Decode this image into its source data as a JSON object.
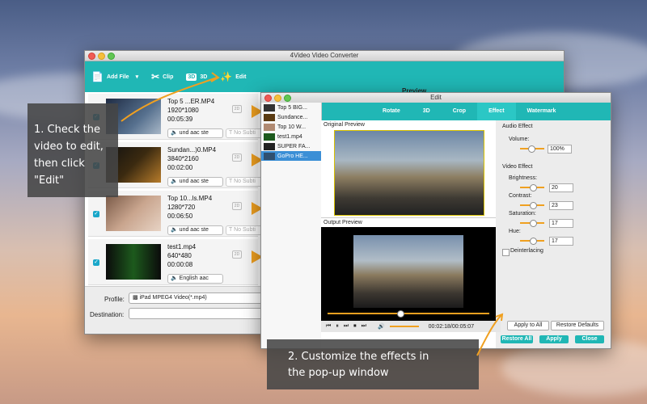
{
  "main_window": {
    "title": "4Video Video Converter",
    "toolbar": {
      "add_file": "Add File",
      "clip": "Clip",
      "three_d": "3D",
      "three_d_badge": "3D",
      "edit": "Edit"
    },
    "files": [
      {
        "name": "Top 5 ...ER.MP4",
        "resolution": "1920*1080",
        "duration": "00:05:39",
        "audio": "und aac ste",
        "subtitle": "No Subti"
      },
      {
        "name": "Sundan...)0.MP4",
        "resolution": "3840*2160",
        "duration": "00:02:00",
        "audio": "und aac ste",
        "subtitle": "No Subti"
      },
      {
        "name": "Top 10...ls.MP4",
        "resolution": "1280*720",
        "duration": "00:06:50",
        "audio": "und aac ste",
        "subtitle": "No Subti"
      },
      {
        "name": "test1.mp4",
        "resolution": "640*480",
        "duration": "00:00:08",
        "audio": "English aac",
        "subtitle": ""
      }
    ],
    "profile_label": "Profile:",
    "profile_value": "iPad MPEG4 Video(*.mp4)",
    "destination_label": "Destination:",
    "preview_label": "Preview",
    "badge_2d": "2D"
  },
  "callout1": {
    "lines": [
      "1. Check the",
      "video to edit,",
      "then click",
      "\"Edit\""
    ]
  },
  "callout2": {
    "lines": [
      "2. Customize the effects in",
      "the pop-up window"
    ]
  },
  "edit_window": {
    "title": "Edit",
    "tabs": [
      "Rotate",
      "3D",
      "Crop",
      "Effect",
      "Watermark"
    ],
    "active_tab": "Effect",
    "files": [
      "Top 5 BIG...",
      "Sundance...",
      "Top 10 W...",
      "test1.mp4",
      "SUPER FA...",
      "GoPro HE..."
    ],
    "selected_file": "GoPro HE...",
    "original_preview": "Original Preview",
    "output_preview": "Output Preview",
    "time": "00:02:18/00:05:07",
    "audio_effect": "Audio Effect",
    "volume_label": "Volume:",
    "volume_value": "100%",
    "video_effect": "Video Effect",
    "brightness_label": "Brightness:",
    "brightness_value": "20",
    "contrast_label": "Contrast:",
    "contrast_value": "23",
    "saturation_label": "Saturation:",
    "saturation_value": "17",
    "hue_label": "Hue:",
    "hue_value": "17",
    "deinterlacing_label": "Deinterlacing",
    "apply_to_all": "Apply to All",
    "restore_defaults": "Restore Defaults",
    "restore_all": "Restore All",
    "apply": "Apply",
    "close": "Close"
  },
  "colors": {
    "accent": "#20b7b5",
    "arrow": "#f0a020",
    "selection": "#3b8fd6"
  }
}
